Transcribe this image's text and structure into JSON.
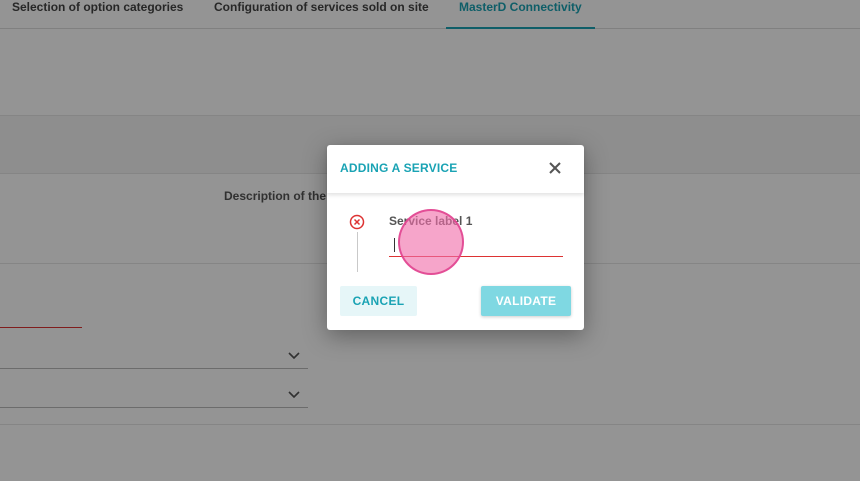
{
  "tabs": [
    {
      "label": "Selection of option categories",
      "active": false
    },
    {
      "label": "Configuration of services sold on site",
      "active": false
    },
    {
      "label": "MasterD Connectivity",
      "active": true
    }
  ],
  "table": {
    "column_description": "Description of the"
  },
  "dialog": {
    "title": "ADDING A SERVICE",
    "close_icon": "close-icon",
    "error_icon": "error-circle-icon",
    "field": {
      "label": "Service label 1",
      "value": "",
      "state": "error"
    },
    "buttons": {
      "cancel_label": "CANCEL",
      "validate_label": "VALIDATE"
    }
  },
  "colors": {
    "accent": "#1aa3b4",
    "validate_bg": "#7fd8e2",
    "cancel_bg": "#e6f6f8",
    "error": "#dd3333",
    "overlay": "rgba(0,0,0,0.42)",
    "cursor_highlight": "#f06eaa"
  }
}
